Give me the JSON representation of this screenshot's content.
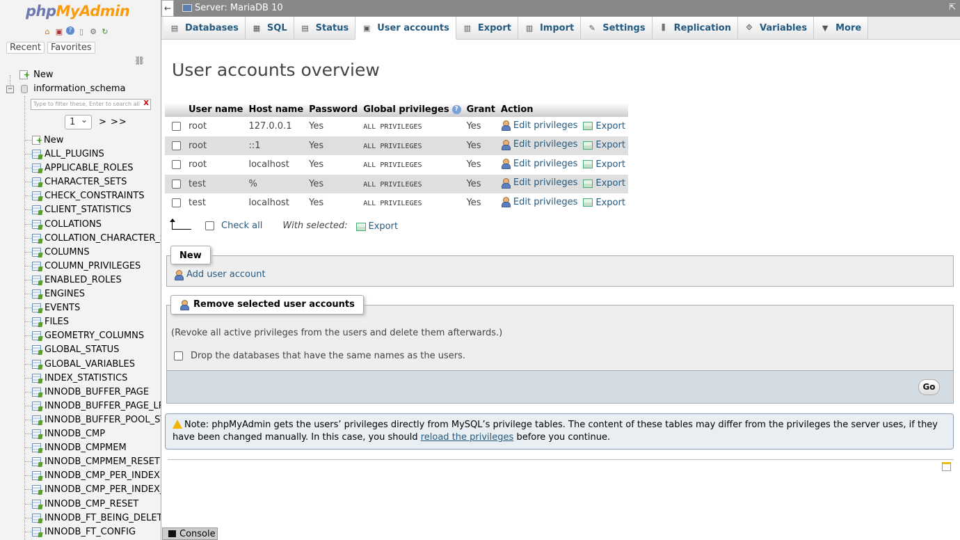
{
  "nav": {
    "logo_php": "php",
    "logo_myadmin": "MyAdmin",
    "icons": [
      "home-icon",
      "database-icon",
      "help-icon",
      "docs-icon",
      "settings-icon",
      "reload-icon"
    ],
    "recent_label": "Recent",
    "favorites_label": "Favorites",
    "tree": {
      "new_label": "New",
      "db_name": "information_schema",
      "filter_placeholder": "Type to filter these, Enter to search all",
      "page_value": "1",
      "pager_next": "> >>",
      "tables_new": "New",
      "tables": [
        "ALL_PLUGINS",
        "APPLICABLE_ROLES",
        "CHARACTER_SETS",
        "CHECK_CONSTRAINTS",
        "CLIENT_STATISTICS",
        "COLLATIONS",
        "COLLATION_CHARACTER_S",
        "COLUMNS",
        "COLUMN_PRIVILEGES",
        "ENABLED_ROLES",
        "ENGINES",
        "EVENTS",
        "FILES",
        "GEOMETRY_COLUMNS",
        "GLOBAL_STATUS",
        "GLOBAL_VARIABLES",
        "INDEX_STATISTICS",
        "INNODB_BUFFER_PAGE",
        "INNODB_BUFFER_PAGE_LR",
        "INNODB_BUFFER_POOL_ST",
        "INNODB_CMP",
        "INNODB_CMPMEM",
        "INNODB_CMPMEM_RESET",
        "INNODB_CMP_PER_INDEX",
        "INNODB_CMP_PER_INDEX_",
        "INNODB_CMP_RESET",
        "INNODB_FT_BEING_DELET",
        "INNODB_FT_CONFIG"
      ]
    }
  },
  "topbar": {
    "back": "←",
    "server": "Server: MariaDB 10",
    "collapse": "⇱"
  },
  "tabs": [
    {
      "label": "Databases",
      "icon": "database-icon",
      "glyph": "▤"
    },
    {
      "label": "SQL",
      "icon": "sql-icon",
      "glyph": "▦"
    },
    {
      "label": "Status",
      "icon": "status-icon",
      "glyph": "▤"
    },
    {
      "label": "User accounts",
      "icon": "users-icon",
      "glyph": "▣"
    },
    {
      "label": "Export",
      "icon": "export-icon",
      "glyph": "▥"
    },
    {
      "label": "Import",
      "icon": "import-icon",
      "glyph": "▥"
    },
    {
      "label": "Settings",
      "icon": "wrench-icon",
      "glyph": "✎"
    },
    {
      "label": "Replication",
      "icon": "replication-icon",
      "glyph": "⫼"
    },
    {
      "label": "Variables",
      "icon": "variables-icon",
      "glyph": "⟐"
    },
    {
      "label": "More",
      "icon": "chevron-down-icon",
      "glyph": "▼"
    }
  ],
  "main": {
    "title": "User accounts overview",
    "table": {
      "headers": [
        "User name",
        "Host name",
        "Password",
        "Global privileges",
        "Grant",
        "Action"
      ],
      "rows": [
        {
          "user": "root",
          "host": "127.0.0.1",
          "password": "Yes",
          "privileges": "ALL PRIVILEGES",
          "grant": "Yes"
        },
        {
          "user": "root",
          "host": "::1",
          "password": "Yes",
          "privileges": "ALL PRIVILEGES",
          "grant": "Yes"
        },
        {
          "user": "root",
          "host": "localhost",
          "password": "Yes",
          "privileges": "ALL PRIVILEGES",
          "grant": "Yes"
        },
        {
          "user": "test",
          "host": "%",
          "password": "Yes",
          "privileges": "ALL PRIVILEGES",
          "grant": "Yes"
        },
        {
          "user": "test",
          "host": "localhost",
          "password": "Yes",
          "privileges": "ALL PRIVILEGES",
          "grant": "Yes"
        }
      ],
      "edit_label": "Edit privileges",
      "export_label": "Export"
    },
    "check_all": "Check all",
    "with_selected": "With selected:",
    "with_selected_export": "Export",
    "new_legend": "New",
    "add_user": "Add user account",
    "remove_legend": "Remove selected user accounts",
    "remove_desc": "(Revoke all active privileges from the users and delete them afterwards.)",
    "drop_dbs": "Drop the databases that have the same names as the users.",
    "go": "Go",
    "note_prefix": "Note: phpMyAdmin gets the users’ privileges directly from MySQL’s privilege tables. The content of these tables may differ from the privileges the server uses, if they have been changed manually. In this case, you should ",
    "note_link": "reload the privileges",
    "note_suffix": " before you continue."
  },
  "console": {
    "label": "Console"
  }
}
